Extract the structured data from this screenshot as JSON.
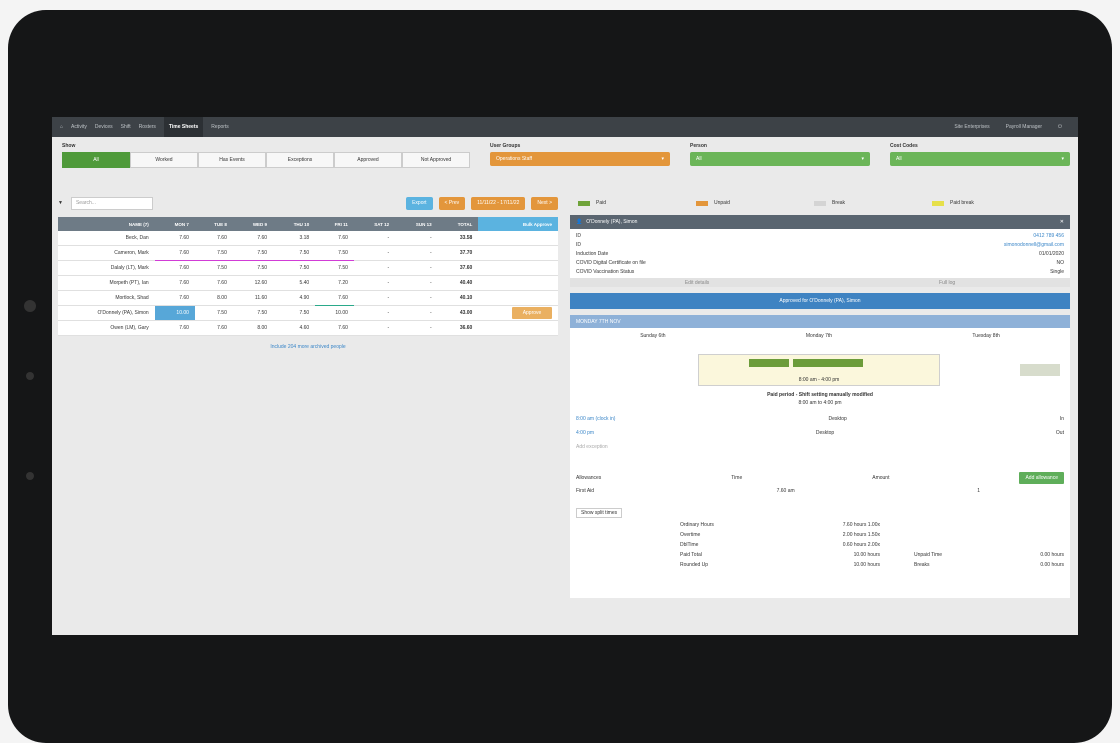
{
  "nav": {
    "items": [
      "Activity",
      "Devices",
      "Shift",
      "Rosters",
      "Time Sheets",
      "Reports"
    ],
    "active": "Time Sheets",
    "right": [
      "Site Enterprises",
      "Payroll Manager"
    ]
  },
  "filters": {
    "show_label": "Show",
    "show_options": [
      "All",
      "Worked",
      "Has Events",
      "Exceptions",
      "Approved",
      "Not Approved"
    ],
    "user_groups_label": "User Groups",
    "user_groups_value": "Operations Staff",
    "person_label": "Person",
    "person_value": "All",
    "cost_codes_label": "Cost Codes",
    "cost_codes_value": "All"
  },
  "toolbar": {
    "search_placeholder": "Search...",
    "export": "Export",
    "prev": "< Prev",
    "range": "11/11/22 - 17/11/22",
    "next": "Next >"
  },
  "table": {
    "headers": [
      "NAME (7)",
      "MON 7",
      "TUE 8",
      "WED 9",
      "THU 10",
      "FRI 11",
      "SAT 12",
      "SUN 13",
      "TOTAL",
      "Bulk Approve"
    ],
    "rows": [
      {
        "name": "Beck, Dan",
        "vals": [
          "7.60",
          "7.60",
          "7.60",
          "3.18",
          "7.60",
          "-",
          "-",
          "33.58"
        ]
      },
      {
        "name": "Cameron, Mark",
        "vals": [
          "7.60",
          "7.50",
          "7.50",
          "7.50",
          "7.50",
          "-",
          "-",
          "37.70"
        ]
      },
      {
        "name": "Dalaly (LT), Mark",
        "vals": [
          "7.60",
          "7.50",
          "7.50",
          "7.50",
          "7.50",
          "-",
          "-",
          "37.60"
        ]
      },
      {
        "name": "Morpeth (PT), Ian",
        "vals": [
          "7.60",
          "7.60",
          "12.60",
          "5.40",
          "7.20",
          "-",
          "-",
          "40.40"
        ]
      },
      {
        "name": "Mortlock, Shad",
        "vals": [
          "7.60",
          "8.00",
          "11.60",
          "4.90",
          "7.60",
          "-",
          "-",
          "40.10"
        ]
      },
      {
        "name": "O'Donnely (PA), Simon",
        "vals": [
          "10.00",
          "7.50",
          "7.50",
          "7.50",
          "10.00",
          "-",
          "-",
          "43.00"
        ]
      },
      {
        "name": "Owen (LM), Gary",
        "vals": [
          "7.60",
          "7.60",
          "8.00",
          "4.60",
          "7.60",
          "-",
          "-",
          "36.60"
        ]
      }
    ],
    "approve_label": "Approve",
    "include_link": "Include 204 more archived people"
  },
  "legend": [
    {
      "label": "Paid",
      "color": "#6fa33a"
    },
    {
      "label": "Unpaid",
      "color": "#e3963b"
    },
    {
      "label": "Break",
      "color": "#d4d4d4"
    },
    {
      "label": "Paid break",
      "color": "#e6e04a"
    }
  ],
  "person": {
    "name": "O'Donnely (PA), Simon",
    "info": [
      [
        "ID",
        "0412 789 456"
      ],
      [
        "ID",
        "simonodonnell@gmail.com"
      ],
      [
        "Induction Date",
        "01/01/2020"
      ],
      [
        "COVID Digital Certificate on file",
        "NO"
      ],
      [
        "COVID Vaccination Status",
        "Single"
      ]
    ],
    "edit": "Edit details",
    "history": "Full log"
  },
  "approved_bar": "Approved for O'Donnely (PA), Simon",
  "sub_bar": "MONDAY 7TH NOV",
  "schedule": {
    "days": [
      "Sunday 6th",
      "Monday 7th",
      "Tuesday 8th"
    ],
    "shift_time": "8:00 am - 4:00 pm",
    "paid_title": "Paid period - Shift setting manually modified",
    "paid_sub": "8:00 am to 4:00 pm",
    "events": [
      {
        "time": "8:00 am (clock in)",
        "device": "Desktop",
        "type": "In"
      },
      {
        "time": "4:00 pm",
        "device": "Desktop",
        "type": "Out"
      }
    ],
    "add_exception": "Add exception",
    "allowances_label": "Allowances",
    "time_label": "Time",
    "amount_label": "Amount",
    "add_allowance": "Add allowance",
    "first_aid": "First Aid",
    "first_aid_time": "7.60 am",
    "first_aid_amount": "1",
    "show_split": "Show split times",
    "hours": [
      [
        "Ordinary Hours",
        "7.60 hours  1.00x"
      ],
      [
        "Overtime",
        "2.00 hours  1.50x"
      ],
      [
        "DblTime",
        "0.60 hours  2.00x"
      ],
      [
        "Paid Total",
        "10.00 hours"
      ],
      [
        "Rounded Up",
        "10.00 hours"
      ]
    ],
    "unpaid_label": "Unpaid Time",
    "unpaid_val": "0.00 hours",
    "breaks_label": "Breaks",
    "breaks_val": "0.00 hours"
  }
}
